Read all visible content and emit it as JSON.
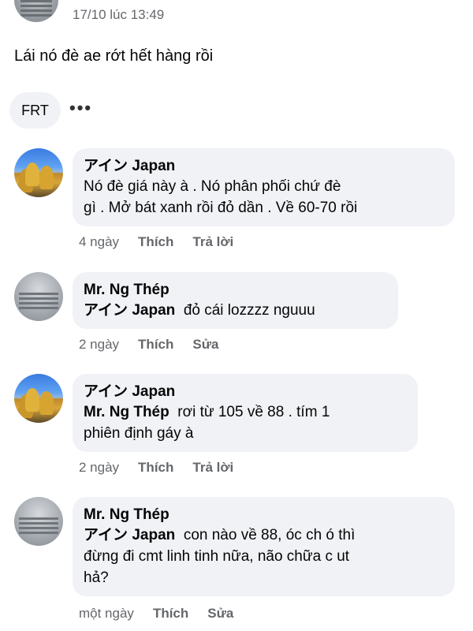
{
  "post": {
    "timestamp": "17/10 lúc 13:49",
    "text": "Lái nó đè ae rớt hết hàng rồi",
    "reaction_label": "FRT",
    "more_label": "•••"
  },
  "comments": [
    {
      "author": "アイン Japan",
      "mention": "",
      "text_lines": [
        "Nó đè giá này à . Nó phân phối chứ đè",
        "gì . Mở bát xanh rồi đỏ dần . Về 60-70 rồi"
      ],
      "time": "4 ngày",
      "like": "Thích",
      "action2": "Trả lời"
    },
    {
      "author": "Mr. Ng Thép",
      "mention": "アイン Japan",
      "text_lines": [
        "đỏ cái lozzzz nguuu"
      ],
      "time": "2 ngày",
      "like": "Thích",
      "action2": "Sửa"
    },
    {
      "author": "アイン Japan",
      "mention": "Mr. Ng Thép",
      "text_lines": [
        "rơi từ 105 về 88 . tím 1",
        "phiên định gáy à"
      ],
      "time": "2 ngày",
      "like": "Thích",
      "action2": "Trả lời"
    },
    {
      "author": "Mr. Ng Thép",
      "mention": "アイン Japan",
      "text_lines": [
        "con nào về 88, óc ch ó thì",
        "đừng đi cmt linh tinh nữa, não chữa c ut",
        "hả?"
      ],
      "time": "một ngày",
      "like": "Thích",
      "action2": "Sửa"
    }
  ]
}
